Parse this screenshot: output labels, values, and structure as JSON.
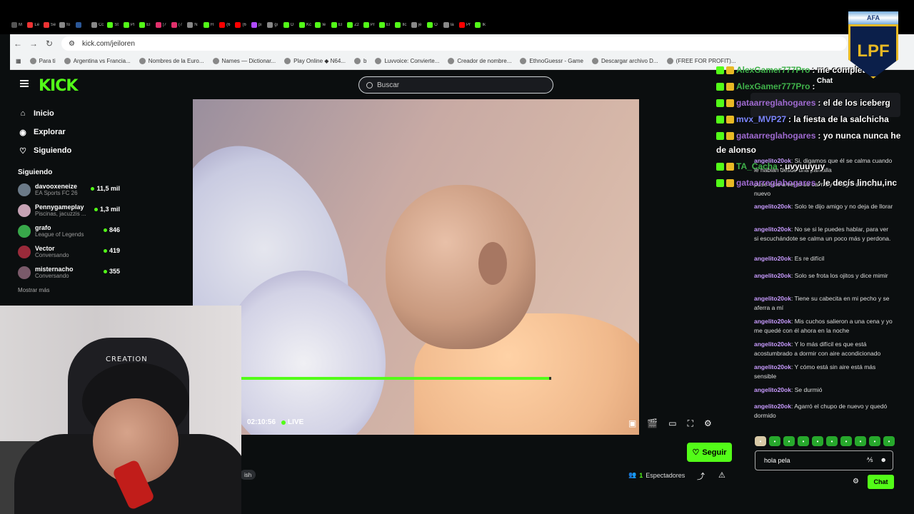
{
  "browser": {
    "url": "kick.com/jeiloren",
    "bookmarks": [
      "Para ti",
      "Argentina vs Francia...",
      "Nombres de la Euro...",
      "Names — Dictionar...",
      "Play Online ◆ N64...",
      "b",
      "Luvvoice: Convierte...",
      "Creador de nombre...",
      "EthnoGuessr - Game",
      "Descargar archivo D...",
      "(FREE FOR PROFIT)..."
    ],
    "tabs": [
      "M",
      "Le",
      "Se",
      "fo",
      "",
      "Cc",
      "St",
      "Pl",
      "El",
      "(7",
      "(7",
      "N",
      "H",
      "(6",
      "(6",
      "pi",
      "gi",
      "O",
      "Kc",
      "le",
      "El",
      "Zz",
      "Pr",
      "El",
      "Ilc",
      "je",
      "O",
      "Ia",
      "Pr",
      "Ik"
    ]
  },
  "kick": {
    "logo": "KICK",
    "search_placeholder": "Buscar",
    "nav": [
      {
        "label": "Inicio",
        "icon": "home-icon"
      },
      {
        "label": "Explorar",
        "icon": "compass-icon"
      },
      {
        "label": "Siguiendo",
        "icon": "heart-icon"
      }
    ],
    "following_title": "Siguiendo",
    "following": [
      {
        "name": "davooxeneize",
        "category": "EA Sports FC 26",
        "viewers": "11,5 mil",
        "color": "#6b7a88"
      },
      {
        "name": "Pennygameplay",
        "category": "Piscinas, jacuzzis ...",
        "viewers": "1,3 mil",
        "color": "#c6a2b4"
      },
      {
        "name": "grafo",
        "category": "League of Legends",
        "viewers": "846",
        "color": "#38a84a"
      },
      {
        "name": "Vector",
        "category": "Conversando",
        "viewers": "419",
        "color": "#9a2a3a"
      },
      {
        "name": "misternacho",
        "category": "Conversando",
        "viewers": "355",
        "color": "#7a5a6a"
      }
    ],
    "show_more": "Mostrar más",
    "player": {
      "time": "02:10:56",
      "live": "LIVE",
      "progress": 0.995
    },
    "follow_button": "Seguir",
    "viewers_count": "1",
    "viewers_label": "Espectadores",
    "tag": "ish"
  },
  "chat": {
    "title": "Chat",
    "pinned_user": "angelito20ok",
    "pinned_text": "Si, digamos que él se calma cuando le hablan desde una pantalla",
    "messages": [
      {
        "user": "angelito20ok",
        "text": "puse esto a ver si se calma y lo logro dormir de nuevo",
        "prefix": false
      },
      {
        "user": "angelito20ok",
        "text": "Solo te dijo amigo y no deja de llorar"
      },
      {
        "user": "angelito20ok",
        "text": "No se si le puedes hablar, para ver si escuchándote se calma un poco más y perdona."
      },
      {
        "user": "angelito20ok",
        "text": "Es re difícil"
      },
      {
        "user": "angelito20ok",
        "text": "Solo se frota los ojitos y dice mimir"
      },
      {
        "user": "angelito20ok",
        "text": "Tiene su cabecita en mi pecho y se aferra a mí"
      },
      {
        "user": "angelito20ok",
        "text": "Mis cuchos salieron a una cena y yo me quedé con él ahora en la noche"
      },
      {
        "user": "angelito20ok",
        "text": "Y lo más difícil es que está acostumbrado a dormir con aire acondicionado"
      },
      {
        "user": "angelito20ok",
        "text": "Y cómo está sin aire está más sensible"
      },
      {
        "user": "angelito20ok",
        "text": "Se durmió"
      },
      {
        "user": "angelito20ok",
        "text": "Agarró el chupo de nuevo y quedó dormido"
      }
    ],
    "input_value": "hola pela",
    "send_label": "Chat"
  },
  "overlay": [
    {
      "user": "AlexGamer777Pro",
      "msg": ": me completo",
      "color": "green"
    },
    {
      "user": "AlexGamer777Pro",
      "msg": ":",
      "color": "green"
    },
    {
      "user": "gataarreglahogares",
      "msg": ": el de los iceberg",
      "color": "purple"
    },
    {
      "user": "mvx_MVP27",
      "msg": ": la fiesta de la salchicha",
      "color": "blue"
    },
    {
      "user": "gataarreglahogares",
      "msg": ": yo nunca nunca he",
      "color": "purple"
    },
    {
      "user": "",
      "msg": "de alonso",
      "color": "purple"
    },
    {
      "user": "TA_Cacha",
      "msg": ": uvyuuyuy",
      "color": "green"
    },
    {
      "user": "gataarreglahogares",
      "msg": ": le decís linchu,inc",
      "color": "purple"
    }
  ],
  "afa_badge": {
    "top": "AFA",
    "emblem": "LPF"
  },
  "webcam": {
    "chair_brand": "CREATION"
  }
}
